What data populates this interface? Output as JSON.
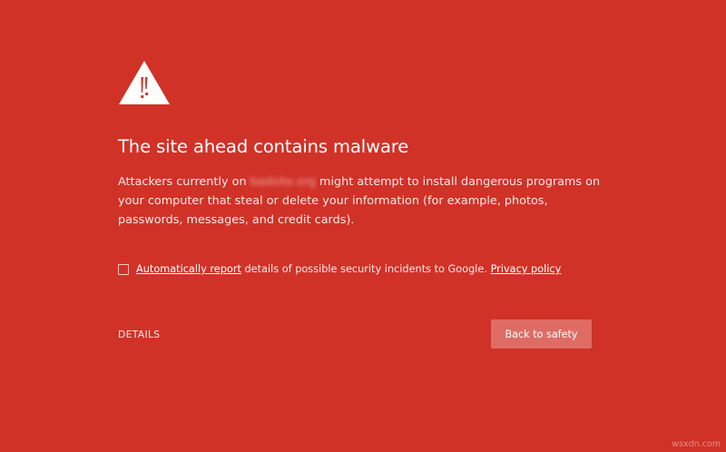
{
  "page": {
    "background_color": "#d03228",
    "accent_button_color": "#df6c64"
  },
  "warning": {
    "icon": "warning-triangle-icon",
    "title": "The site ahead contains malware",
    "body_prefix": "Attackers currently on",
    "domain": "badsite.org",
    "body_suffix": "might attempt to install dangerous programs on your computer that steal or delete your information (for example, photos, passwords, messages, and credit cards)."
  },
  "report": {
    "checkbox_checked": false,
    "link_label": "Automatically report",
    "text": "details of possible security incidents to Google.",
    "privacy_label": "Privacy policy"
  },
  "actions": {
    "details_label": "DETAILS",
    "back_label": "Back to safety"
  },
  "watermark": "wsxdn.com"
}
